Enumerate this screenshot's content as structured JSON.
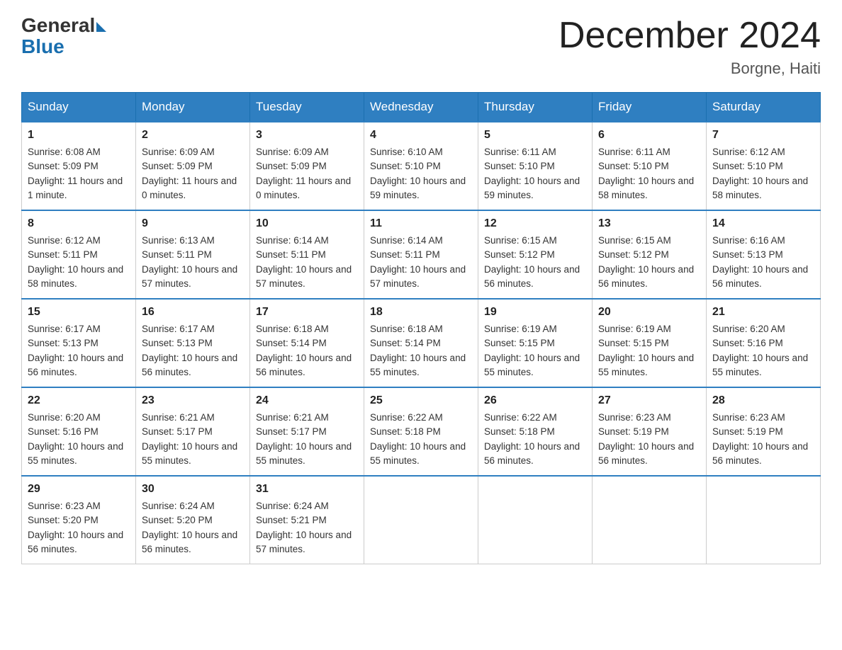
{
  "header": {
    "logo_general": "General",
    "logo_blue": "Blue",
    "month_title": "December 2024",
    "location": "Borgne, Haiti"
  },
  "days_of_week": [
    "Sunday",
    "Monday",
    "Tuesday",
    "Wednesday",
    "Thursday",
    "Friday",
    "Saturday"
  ],
  "weeks": [
    [
      {
        "day": "1",
        "sunrise": "Sunrise: 6:08 AM",
        "sunset": "Sunset: 5:09 PM",
        "daylight": "Daylight: 11 hours and 1 minute."
      },
      {
        "day": "2",
        "sunrise": "Sunrise: 6:09 AM",
        "sunset": "Sunset: 5:09 PM",
        "daylight": "Daylight: 11 hours and 0 minutes."
      },
      {
        "day": "3",
        "sunrise": "Sunrise: 6:09 AM",
        "sunset": "Sunset: 5:09 PM",
        "daylight": "Daylight: 11 hours and 0 minutes."
      },
      {
        "day": "4",
        "sunrise": "Sunrise: 6:10 AM",
        "sunset": "Sunset: 5:10 PM",
        "daylight": "Daylight: 10 hours and 59 minutes."
      },
      {
        "day": "5",
        "sunrise": "Sunrise: 6:11 AM",
        "sunset": "Sunset: 5:10 PM",
        "daylight": "Daylight: 10 hours and 59 minutes."
      },
      {
        "day": "6",
        "sunrise": "Sunrise: 6:11 AM",
        "sunset": "Sunset: 5:10 PM",
        "daylight": "Daylight: 10 hours and 58 minutes."
      },
      {
        "day": "7",
        "sunrise": "Sunrise: 6:12 AM",
        "sunset": "Sunset: 5:10 PM",
        "daylight": "Daylight: 10 hours and 58 minutes."
      }
    ],
    [
      {
        "day": "8",
        "sunrise": "Sunrise: 6:12 AM",
        "sunset": "Sunset: 5:11 PM",
        "daylight": "Daylight: 10 hours and 58 minutes."
      },
      {
        "day": "9",
        "sunrise": "Sunrise: 6:13 AM",
        "sunset": "Sunset: 5:11 PM",
        "daylight": "Daylight: 10 hours and 57 minutes."
      },
      {
        "day": "10",
        "sunrise": "Sunrise: 6:14 AM",
        "sunset": "Sunset: 5:11 PM",
        "daylight": "Daylight: 10 hours and 57 minutes."
      },
      {
        "day": "11",
        "sunrise": "Sunrise: 6:14 AM",
        "sunset": "Sunset: 5:11 PM",
        "daylight": "Daylight: 10 hours and 57 minutes."
      },
      {
        "day": "12",
        "sunrise": "Sunrise: 6:15 AM",
        "sunset": "Sunset: 5:12 PM",
        "daylight": "Daylight: 10 hours and 56 minutes."
      },
      {
        "day": "13",
        "sunrise": "Sunrise: 6:15 AM",
        "sunset": "Sunset: 5:12 PM",
        "daylight": "Daylight: 10 hours and 56 minutes."
      },
      {
        "day": "14",
        "sunrise": "Sunrise: 6:16 AM",
        "sunset": "Sunset: 5:13 PM",
        "daylight": "Daylight: 10 hours and 56 minutes."
      }
    ],
    [
      {
        "day": "15",
        "sunrise": "Sunrise: 6:17 AM",
        "sunset": "Sunset: 5:13 PM",
        "daylight": "Daylight: 10 hours and 56 minutes."
      },
      {
        "day": "16",
        "sunrise": "Sunrise: 6:17 AM",
        "sunset": "Sunset: 5:13 PM",
        "daylight": "Daylight: 10 hours and 56 minutes."
      },
      {
        "day": "17",
        "sunrise": "Sunrise: 6:18 AM",
        "sunset": "Sunset: 5:14 PM",
        "daylight": "Daylight: 10 hours and 56 minutes."
      },
      {
        "day": "18",
        "sunrise": "Sunrise: 6:18 AM",
        "sunset": "Sunset: 5:14 PM",
        "daylight": "Daylight: 10 hours and 55 minutes."
      },
      {
        "day": "19",
        "sunrise": "Sunrise: 6:19 AM",
        "sunset": "Sunset: 5:15 PM",
        "daylight": "Daylight: 10 hours and 55 minutes."
      },
      {
        "day": "20",
        "sunrise": "Sunrise: 6:19 AM",
        "sunset": "Sunset: 5:15 PM",
        "daylight": "Daylight: 10 hours and 55 minutes."
      },
      {
        "day": "21",
        "sunrise": "Sunrise: 6:20 AM",
        "sunset": "Sunset: 5:16 PM",
        "daylight": "Daylight: 10 hours and 55 minutes."
      }
    ],
    [
      {
        "day": "22",
        "sunrise": "Sunrise: 6:20 AM",
        "sunset": "Sunset: 5:16 PM",
        "daylight": "Daylight: 10 hours and 55 minutes."
      },
      {
        "day": "23",
        "sunrise": "Sunrise: 6:21 AM",
        "sunset": "Sunset: 5:17 PM",
        "daylight": "Daylight: 10 hours and 55 minutes."
      },
      {
        "day": "24",
        "sunrise": "Sunrise: 6:21 AM",
        "sunset": "Sunset: 5:17 PM",
        "daylight": "Daylight: 10 hours and 55 minutes."
      },
      {
        "day": "25",
        "sunrise": "Sunrise: 6:22 AM",
        "sunset": "Sunset: 5:18 PM",
        "daylight": "Daylight: 10 hours and 55 minutes."
      },
      {
        "day": "26",
        "sunrise": "Sunrise: 6:22 AM",
        "sunset": "Sunset: 5:18 PM",
        "daylight": "Daylight: 10 hours and 56 minutes."
      },
      {
        "day": "27",
        "sunrise": "Sunrise: 6:23 AM",
        "sunset": "Sunset: 5:19 PM",
        "daylight": "Daylight: 10 hours and 56 minutes."
      },
      {
        "day": "28",
        "sunrise": "Sunrise: 6:23 AM",
        "sunset": "Sunset: 5:19 PM",
        "daylight": "Daylight: 10 hours and 56 minutes."
      }
    ],
    [
      {
        "day": "29",
        "sunrise": "Sunrise: 6:23 AM",
        "sunset": "Sunset: 5:20 PM",
        "daylight": "Daylight: 10 hours and 56 minutes."
      },
      {
        "day": "30",
        "sunrise": "Sunrise: 6:24 AM",
        "sunset": "Sunset: 5:20 PM",
        "daylight": "Daylight: 10 hours and 56 minutes."
      },
      {
        "day": "31",
        "sunrise": "Sunrise: 6:24 AM",
        "sunset": "Sunset: 5:21 PM",
        "daylight": "Daylight: 10 hours and 57 minutes."
      },
      null,
      null,
      null,
      null
    ]
  ]
}
